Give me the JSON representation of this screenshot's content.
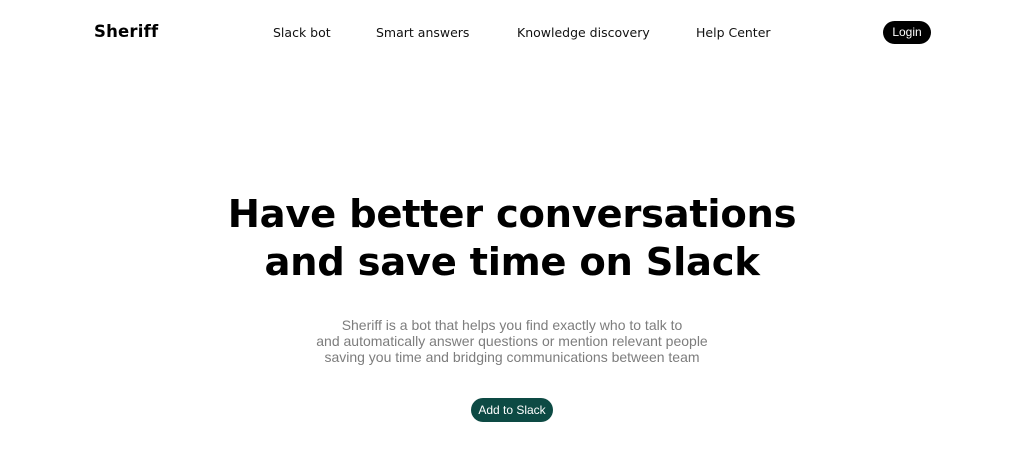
{
  "header": {
    "logo": "Sheriff",
    "nav": [
      {
        "label": "Slack bot"
      },
      {
        "label": "Smart answers"
      },
      {
        "label": "Knowledge discovery"
      },
      {
        "label": "Help Center"
      }
    ],
    "login_label": "Login"
  },
  "hero": {
    "title_lines": [
      "Have better conversations",
      "and save time on Slack"
    ],
    "description_lines": [
      "Sheriff is a bot that helps you find exactly who to talk to",
      "and automatically answer questions or mention relevant people",
      "saving you time and bridging communications between team"
    ],
    "cta_label": "Add to Slack"
  },
  "colors": {
    "background": "#ffffff",
    "text": "#000000",
    "description": "#7d7d7d",
    "login_bg": "#000000",
    "cta_bg": "#0d4a44"
  }
}
